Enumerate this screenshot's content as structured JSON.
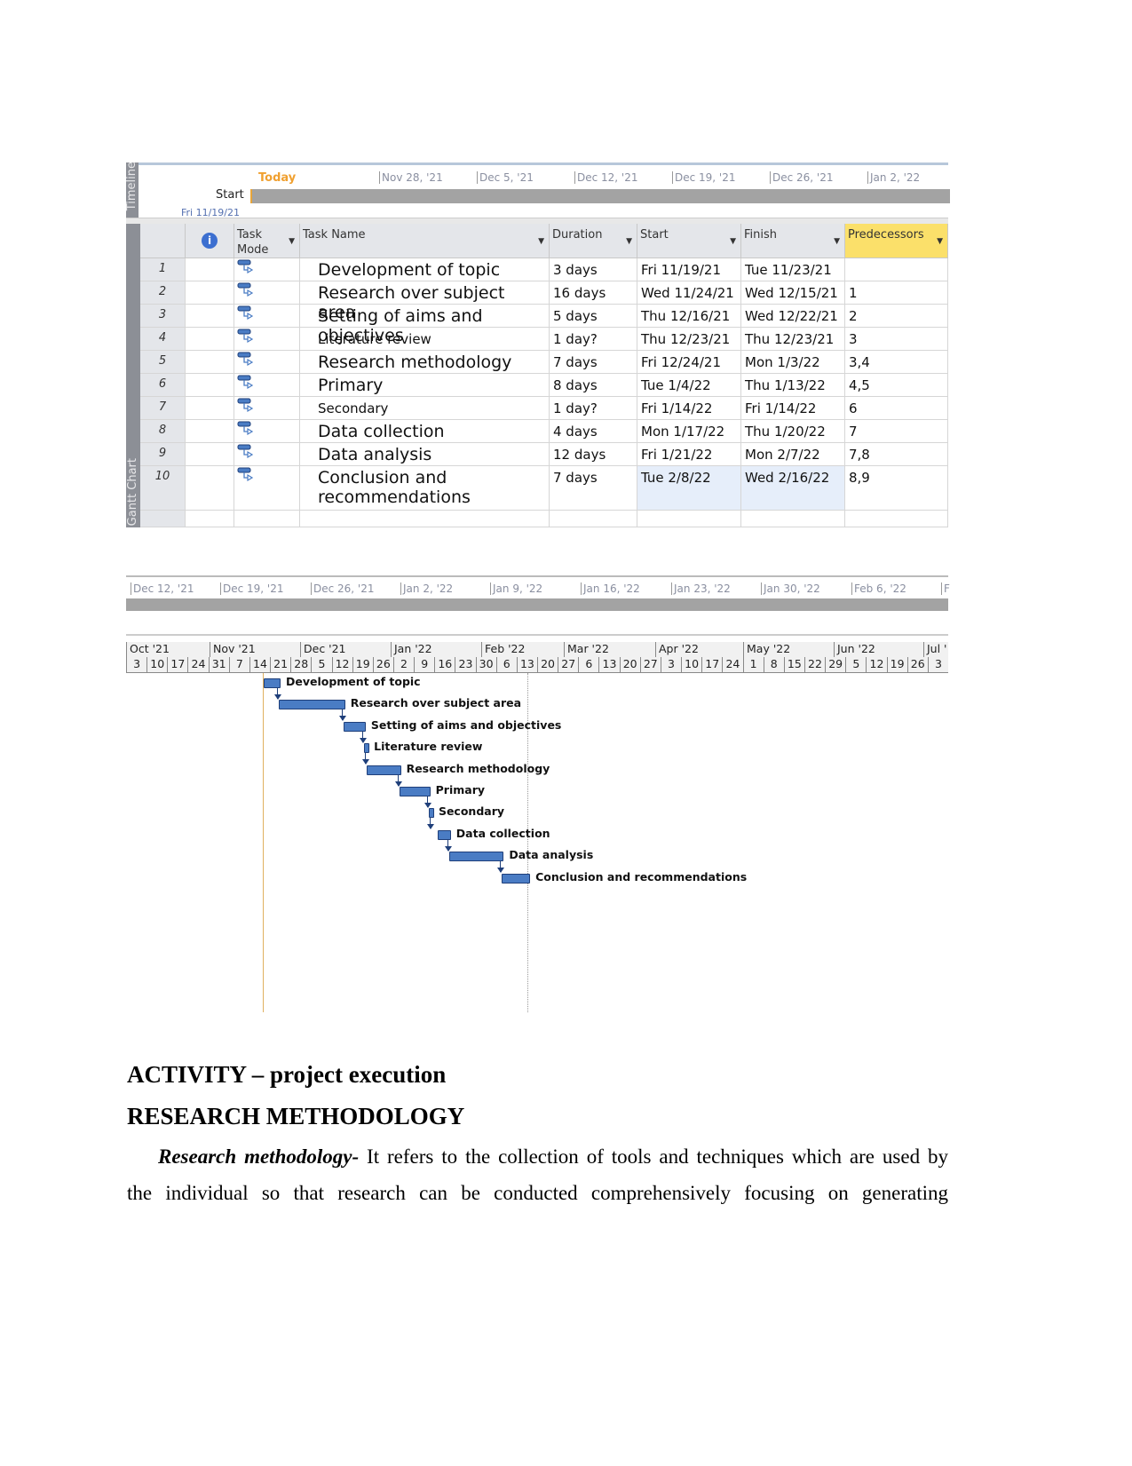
{
  "timeline1": {
    "today": "Today",
    "dates": [
      "Nov 28, '21",
      "Dec 5, '21",
      "Dec 12, '21",
      "Dec 19, '21",
      "Dec 26, '21",
      "Jan 2, '22"
    ],
    "start_label": "Start",
    "start_date": "Fri 11/19/21",
    "side_label": "Timeline"
  },
  "table": {
    "headers": {
      "mode": "Task Mode",
      "name": "Task Name",
      "duration": "Duration",
      "start": "Start",
      "finish": "Finish",
      "predecessors": "Predecessors"
    },
    "side_label": "Gantt Chart",
    "rows": [
      {
        "id": "1",
        "name": "Development of topic",
        "duration": "3 days",
        "start": "Fri 11/19/21",
        "finish": "Tue 11/23/21",
        "pred": "",
        "size": "big"
      },
      {
        "id": "2",
        "name": "Research over subject area",
        "duration": "16 days",
        "start": "Wed 11/24/21",
        "finish": "Wed 12/15/21",
        "pred": "1",
        "size": "big"
      },
      {
        "id": "3",
        "name": "Setting of aims and objectives",
        "duration": "5 days",
        "start": "Thu 12/16/21",
        "finish": "Wed 12/22/21",
        "pred": "2",
        "size": "big"
      },
      {
        "id": "4",
        "name": "Literature review",
        "duration": "1 day?",
        "start": "Thu 12/23/21",
        "finish": "Thu 12/23/21",
        "pred": "3",
        "size": "small"
      },
      {
        "id": "5",
        "name": "Research methodology",
        "duration": "7 days",
        "start": "Fri 12/24/21",
        "finish": "Mon 1/3/22",
        "pred": "3,4",
        "size": "big"
      },
      {
        "id": "6",
        "name": "Primary",
        "duration": "8 days",
        "start": "Tue 1/4/22",
        "finish": "Thu 1/13/22",
        "pred": "4,5",
        "size": "big"
      },
      {
        "id": "7",
        "name": "Secondary",
        "duration": "1 day?",
        "start": "Fri 1/14/22",
        "finish": "Fri 1/14/22",
        "pred": "6",
        "size": "small"
      },
      {
        "id": "8",
        "name": "Data collection",
        "duration": "4 days",
        "start": "Mon 1/17/22",
        "finish": "Thu 1/20/22",
        "pred": "7",
        "size": "big"
      },
      {
        "id": "9",
        "name": "Data analysis",
        "duration": "12 days",
        "start": "Fri 1/21/22",
        "finish": "Mon 2/7/22",
        "pred": "7,8",
        "size": "big"
      },
      {
        "id": "10",
        "name": "Conclusion and recommendations",
        "duration": "7 days",
        "start": "Tue 2/8/22",
        "finish": "Wed 2/16/22",
        "pred": "8,9",
        "size": "big"
      }
    ]
  },
  "timeline2": {
    "dates": [
      "Dec 12, '21",
      "Dec 19, '21",
      "Dec 26, '21",
      "Jan 2, '22",
      "Jan 9, '22",
      "Jan 16, '22",
      "Jan 23, '22",
      "Jan 30, '22",
      "Feb 6, '22",
      "F"
    ]
  },
  "gantt": {
    "months": [
      "Oct '21",
      "Nov '21",
      "Dec '21",
      "Jan '22",
      "Feb '22",
      "Mar '22",
      "Apr '22",
      "May '22",
      "Jun '22",
      "Jul '"
    ],
    "weeks": [
      "3",
      "10",
      "17",
      "24",
      "31",
      "7",
      "14",
      "21",
      "28",
      "5",
      "12",
      "19",
      "26",
      "2",
      "9",
      "16",
      "23",
      "30",
      "6",
      "13",
      "20",
      "27",
      "6",
      "13",
      "20",
      "27",
      "3",
      "10",
      "17",
      "24",
      "1",
      "8",
      "15",
      "22",
      "29",
      "5",
      "12",
      "19",
      "26",
      "3"
    ],
    "bar_color": "#4a7cc4"
  },
  "doc": {
    "heading1": "ACTIVITY – project execution",
    "heading2": "RESEARCH METHODOLOGY",
    "para_lead": "Research methodology-",
    "para_line1": " It refers to the collection of tools and techniques which are used by",
    "para_line2": "the individual so that research can be conducted comprehensively focusing on generating"
  }
}
